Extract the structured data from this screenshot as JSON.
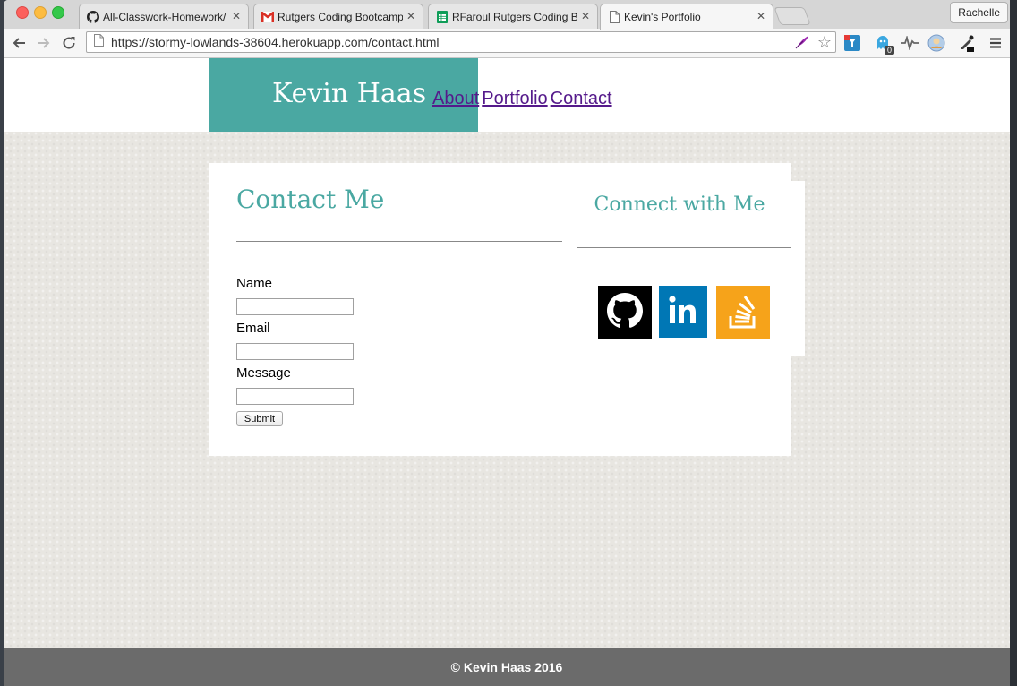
{
  "browser": {
    "tabs": [
      {
        "label": "All-Classwork-Homework/",
        "favicon": "github-icon"
      },
      {
        "label": "Rutgers Coding Bootcamp",
        "favicon": "gmail-icon"
      },
      {
        "label": "RFaroul Rutgers Coding Bo",
        "favicon": "sheets-icon"
      },
      {
        "label": "Kevin's Portfolio",
        "favicon": "page-icon"
      }
    ],
    "profile_name": "Rachelle",
    "url": "https://stormy-lowlands-38604.herokuapp.com/contact.html",
    "extension_badge": "0"
  },
  "site": {
    "brand": "Kevin Haas",
    "nav": [
      "About",
      "Portfolio",
      "Contact"
    ],
    "contact": {
      "title": "Contact Me",
      "name_label": "Name",
      "email_label": "Email",
      "message_label": "Message",
      "name_value": "",
      "email_value": "",
      "message_value": "",
      "submit_label": "Submit"
    },
    "connect": {
      "title": "Connect with Me",
      "links": [
        {
          "name": "github-icon",
          "color": "#000000"
        },
        {
          "name": "linkedin-icon",
          "color": "#0077b5"
        },
        {
          "name": "stackoverflow-icon",
          "color": "#f6a31a"
        }
      ]
    },
    "footer": "© Kevin Haas 2016"
  },
  "colors": {
    "accent": "#4aa8a2",
    "nav_link": "#551a8b",
    "footer_bg": "#6b6b6b"
  }
}
